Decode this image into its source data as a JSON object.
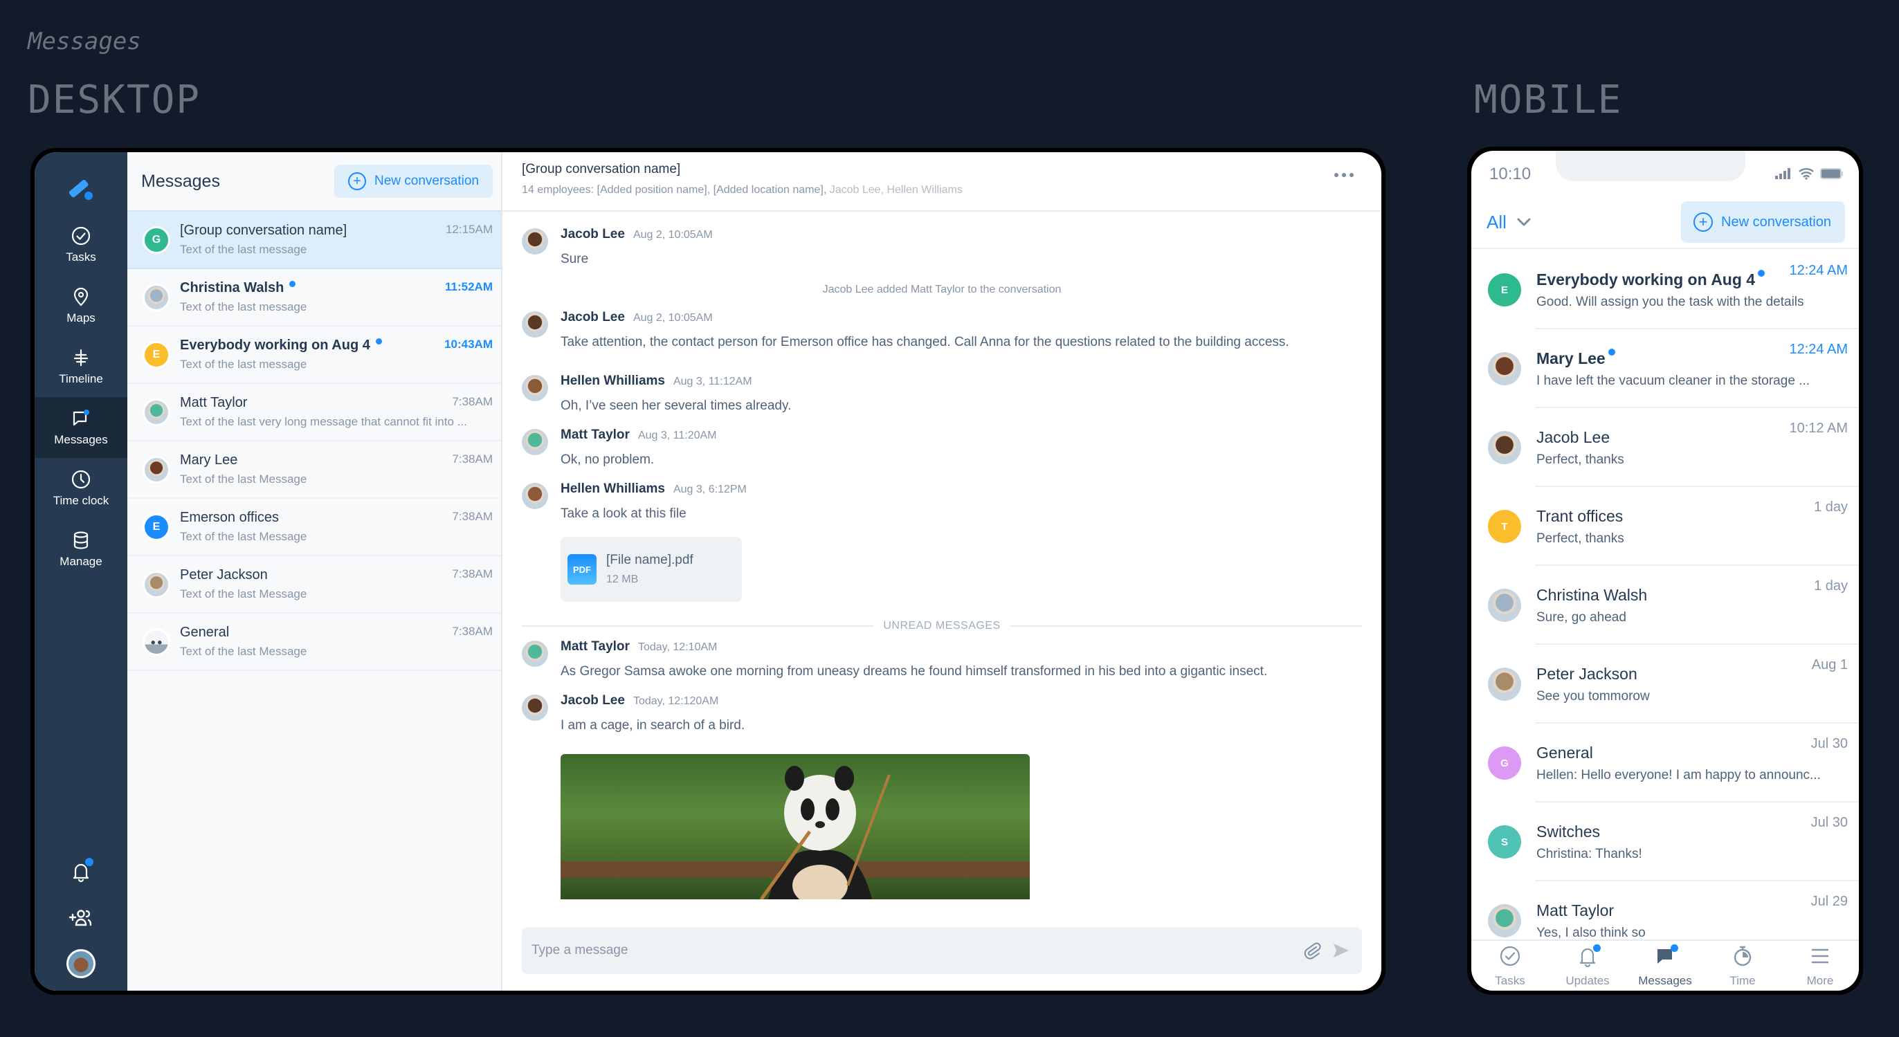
{
  "page_label": "Messages",
  "sections": {
    "desktop": "DESKTOP",
    "mobile": "MOBILE"
  },
  "colors": {
    "accent": "#1a8cff",
    "nav_bg": "#263a51",
    "nav_active": "#1b2a3b",
    "selected_row": "#deedfb",
    "page_bg": "#131a29"
  },
  "desktop": {
    "nav": {
      "items": [
        {
          "label": "Tasks",
          "icon": "check-circle-icon"
        },
        {
          "label": "Maps",
          "icon": "map-pin-icon"
        },
        {
          "label": "Timeline",
          "icon": "timeline-icon"
        },
        {
          "label": "Messages",
          "icon": "chat-icon",
          "active": true,
          "badge": true
        },
        {
          "label": "Time clock",
          "icon": "clock-icon"
        },
        {
          "label": "Manage",
          "icon": "database-icon"
        }
      ],
      "bottom": [
        {
          "icon": "bell-icon",
          "badge": true
        },
        {
          "icon": "add-user-icon"
        },
        {
          "icon": "user-avatar"
        }
      ]
    },
    "list": {
      "title": "Messages",
      "new_button": "New conversation",
      "conversations": [
        {
          "name": "[Group conversation name]",
          "last": "Text of the last message",
          "time": "12:15AM",
          "avatar": "G",
          "color": "#2fb98f",
          "selected": true,
          "unread": false
        },
        {
          "name": "Christina Walsh",
          "last": "Text of the last message",
          "time": "11:52AM",
          "avatar": "photo",
          "color": "#9fb4c6",
          "unread": true
        },
        {
          "name": "Everybody working on Aug 4",
          "last": "Text of the last message",
          "time": "10:43AM",
          "avatar": "E",
          "color": "#fbbd2b",
          "unread": true
        },
        {
          "name": "Matt Taylor",
          "last": "Text of the last very long message that cannot fit into  ...",
          "time": "7:38AM",
          "avatar": "photo",
          "color": "#4fb89a",
          "unread": false
        },
        {
          "name": "Mary Lee",
          "last": "Text of the last Message",
          "time": "7:38AM",
          "avatar": "photo",
          "color": "#6b3d24",
          "unread": false
        },
        {
          "name": "Emerson offices",
          "last": "Text of the last Message",
          "time": "7:38AM",
          "avatar": "E",
          "color": "#1a8cff",
          "unread": false
        },
        {
          "name": "Peter Jackson",
          "last": "Text of the last Message",
          "time": "7:38AM",
          "avatar": "photo",
          "color": "#a88b6a",
          "unread": false
        },
        {
          "name": "General",
          "last": "Text of the last Message",
          "time": "7:38AM",
          "avatar": "panda",
          "color": "#e6ebf0",
          "unread": false
        }
      ]
    },
    "chat": {
      "title": "[Group conversation name]",
      "subtitle": "14 employees: [Added position name], [Added location name],",
      "subtitle_muted": " Jacob Lee, Hellen Williams",
      "messages": [
        {
          "author": "Jacob Lee",
          "time": "Aug 2, 10:05AM",
          "text": "Sure"
        },
        {
          "system": "Jacob Lee added Matt Taylor to the conversation"
        },
        {
          "author": "Jacob Lee",
          "time": "Aug 2, 10:05AM",
          "text": "Take attention, the contact person for Emerson office has changed. Call Anna for the questions related to the building access."
        },
        {
          "author": "Hellen Whilliams",
          "time": "Aug 3, 11:12AM",
          "text": "Oh, I’ve seen her several times already."
        },
        {
          "author": "Matt Taylor",
          "time": "Aug 3, 11:20AM",
          "text": "Ok, no problem."
        },
        {
          "author": "Hellen Whilliams",
          "time": "Aug 3, 6:12PM",
          "text": "Take a look at this file",
          "file": {
            "name": "[File name].pdf",
            "size": "12 MB",
            "type": "PDF"
          }
        },
        {
          "divider": "UNREAD MESSAGES"
        },
        {
          "author": "Matt Taylor",
          "time": "Today, 12:10AM",
          "text": "As Gregor Samsa awoke one morning from uneasy dreams he found himself transformed in his bed into a gigantic insect."
        },
        {
          "author": "Jacob Lee",
          "time": "Today, 12:120AM",
          "text": "I am a cage, in search of a bird.",
          "image": "panda-photo"
        }
      ],
      "composer_placeholder": "Type a message"
    }
  },
  "mobile": {
    "status_time": "10:10",
    "filter": "All",
    "new_button": "New conversation",
    "conversations": [
      {
        "name": "Everybody working on Aug 4",
        "last": "Good. Will assign you the task with the details",
        "time": "12:24 AM",
        "avatar": "E",
        "color": "#2fb98f",
        "unread": true
      },
      {
        "name": "Mary Lee",
        "last": "I have left the vacuum cleaner in  the storage ...",
        "time": "12:24 AM",
        "avatar": "photo",
        "color": "#6b3d24",
        "unread": true
      },
      {
        "name": "Jacob Lee",
        "last": "Perfect, thanks",
        "time": "10:12 AM",
        "avatar": "photo",
        "color": "#5a3826",
        "unread": false
      },
      {
        "name": "Trant offices",
        "last": "Perfect, thanks",
        "time": "1 day",
        "avatar": "T",
        "color": "#fbbd2b",
        "unread": false
      },
      {
        "name": "Christina Walsh",
        "last": "Sure, go ahead",
        "time": "1 day",
        "avatar": "photo",
        "color": "#9fb4c6",
        "unread": false
      },
      {
        "name": "Peter Jackson",
        "last": "See you tommorow",
        "time": "Aug 1",
        "avatar": "photo",
        "color": "#a88b6a",
        "unread": false
      },
      {
        "name": "General",
        "last": "Hellen: Hello everyone! I am happy to announc...",
        "time": "Jul 30",
        "avatar": "G",
        "color": "#dc9af5",
        "unread": false
      },
      {
        "name": "Switches",
        "last": "Christina: Thanks!",
        "time": "Jul 30",
        "avatar": "S",
        "color": "#4fc4b4",
        "unread": false
      },
      {
        "name": "Matt Taylor",
        "last": "Yes, I also think so",
        "time": "Jul 29",
        "avatar": "photo",
        "color": "#4fb89a",
        "unread": false
      }
    ],
    "tabs": [
      {
        "label": "Tasks",
        "icon": "check-circle-icon"
      },
      {
        "label": "Updates",
        "icon": "bell-icon",
        "badge": true
      },
      {
        "label": "Messages",
        "icon": "chat-icon",
        "badge": true,
        "active": true
      },
      {
        "label": "Time",
        "icon": "stopwatch-icon"
      },
      {
        "label": "More",
        "icon": "menu-icon"
      }
    ]
  }
}
